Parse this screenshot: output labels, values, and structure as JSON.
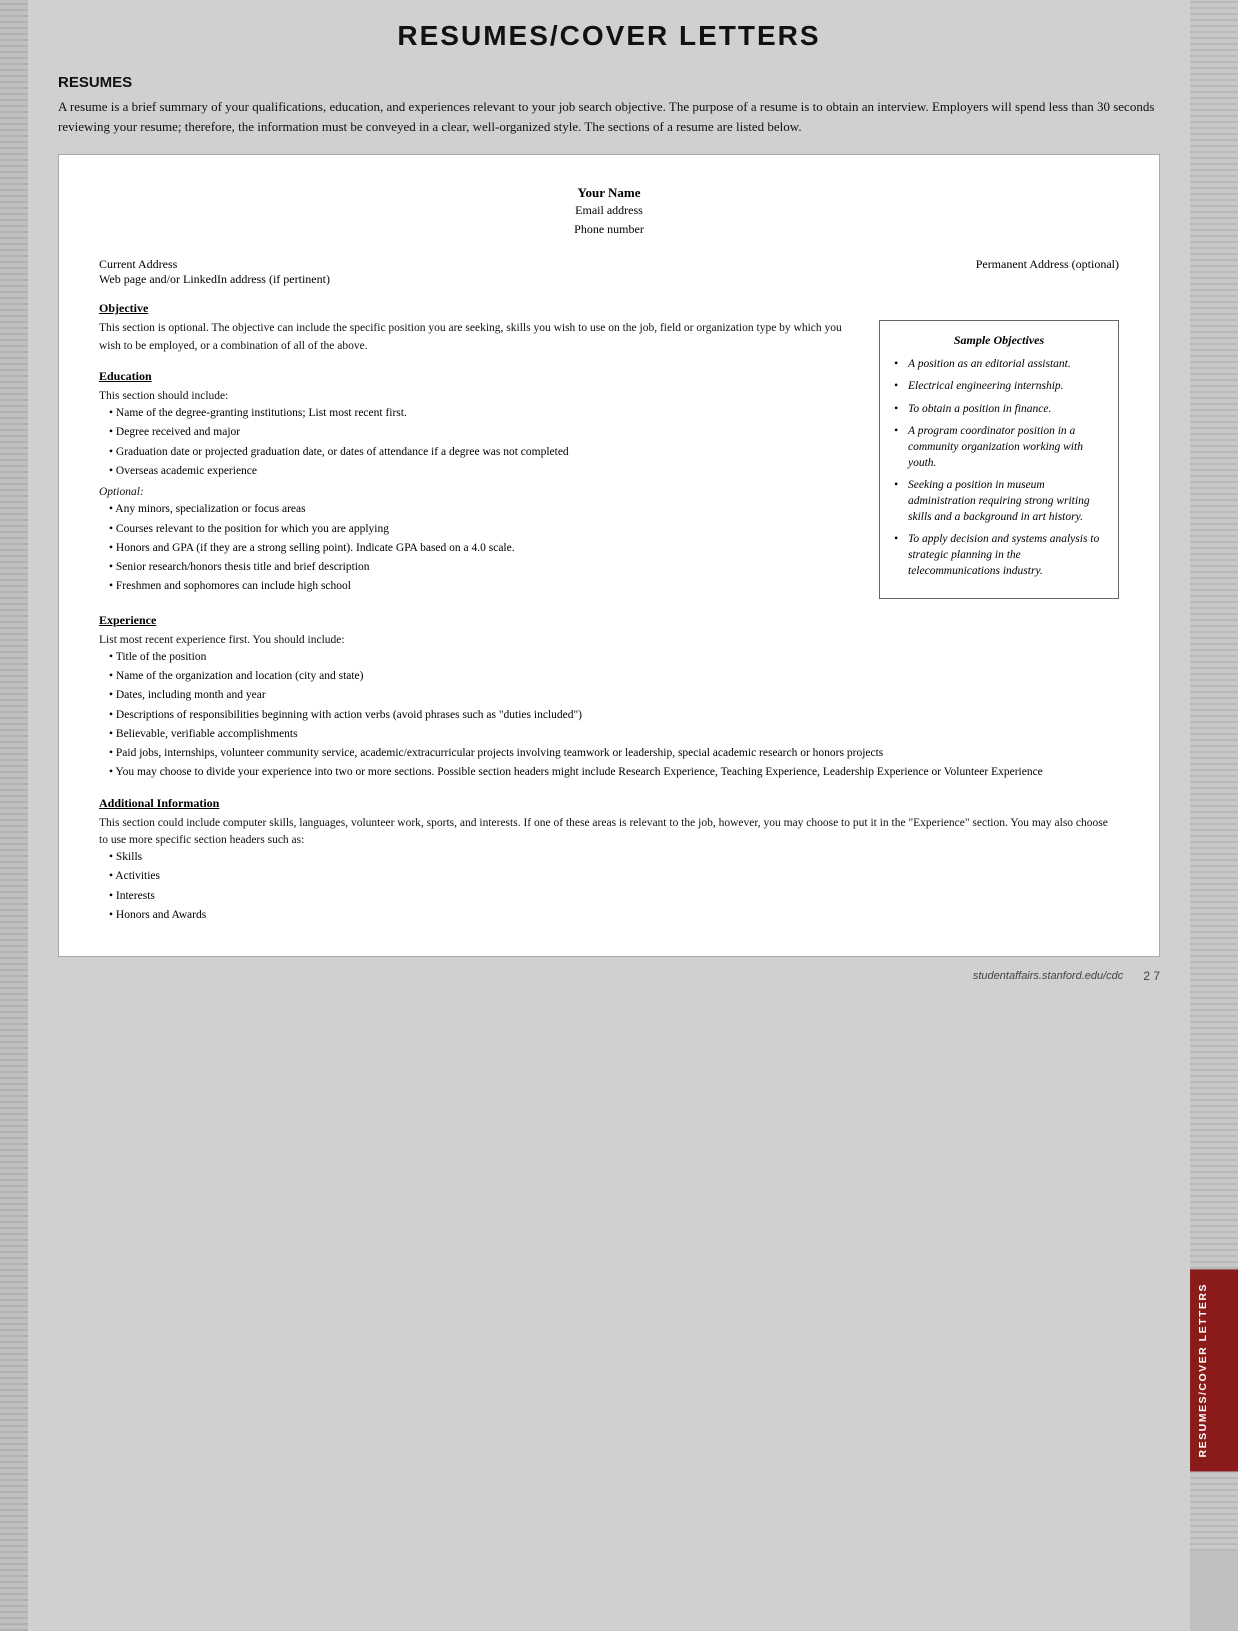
{
  "page": {
    "title": "RESUMES/COVER LETTERS",
    "footer_url": "studentaffairs.stanford.edu/cdc",
    "footer_page": "2 7"
  },
  "resumes_section": {
    "heading": "RESUMES",
    "intro": "A resume is a brief summary of your qualifications, education, and experiences relevant to your job search objective. The purpose of a resume is to obtain an interview. Employers will spend less than 30 seconds reviewing your resume; therefore, the information must be conveyed in a clear, well-organized style. The sections of a resume are listed below."
  },
  "resume_template": {
    "your_name": "Your Name",
    "email": "Email address",
    "phone": "Phone number",
    "current_address": "Current Address",
    "web_address": "Web page and/or LinkedIn address (if pertinent)",
    "permanent_address": "Permanent Address (optional)"
  },
  "resume_sections": {
    "objective": {
      "title": "Objective",
      "body": "This section is optional. The objective can include the specific position you are seeking, skills you wish to use on the job, field or organization type by which you wish to be employed, or a combination of all of the above."
    },
    "education": {
      "title": "Education",
      "intro": "This section should include:",
      "bullets": [
        "Name of the degree-granting institutions; List most recent first.",
        "Degree received and major",
        "Graduation date or projected graduation date, or dates of attendance if a degree was not completed",
        "Overseas academic experience"
      ],
      "optional_label": "Optional:",
      "optional_bullets": [
        "Any minors, specialization or focus areas",
        "Courses relevant to the position for which you are applying",
        "Honors and GPA (if they are a strong selling point). Indicate GPA based on a 4.0 scale.",
        "Senior research/honors thesis title and brief description",
        "Freshmen and sophomores can include high school"
      ]
    },
    "experience": {
      "title": "Experience",
      "intro": "List most recent experience first. You should include:",
      "bullets": [
        "Title of the position",
        "Name of the organization and location (city and state)",
        "Dates, including month and year",
        "Descriptions of responsibilities beginning with action verbs (avoid phrases such as \"duties included\")",
        "Believable, verifiable accomplishments",
        "Paid jobs, internships, volunteer community service, academic/extracurricular projects involving teamwork or leadership, special academic research or honors projects",
        "You may choose to divide your experience into two or more sections. Possible section headers might include Research Experience, Teaching Experience, Leadership Experience or Volunteer Experience"
      ]
    },
    "additional_information": {
      "title": "Additional Information",
      "body": "This section could include computer skills, languages, volunteer work, sports, and interests. If one of these areas is relevant to the job, however, you may choose to put it in the \"Experience\" section. You may also choose to use more specific section headers such as:",
      "bullets": [
        "Skills",
        "Activities",
        "Interests",
        "Honors and Awards"
      ]
    }
  },
  "sample_objectives": {
    "box_title": "Sample Objectives",
    "items": [
      "A position as an editorial assistant.",
      "Electrical engineering internship.",
      "To obtain a position in finance.",
      "A program coordinator position in a community organization working with youth.",
      "Seeking a position in museum administration requiring strong writing skills and a background in art history.",
      "To apply decision and systems analysis to strategic planning in the telecommunications industry."
    ]
  },
  "sidebar": {
    "label": "RESUMES/COVER LETTERS"
  }
}
